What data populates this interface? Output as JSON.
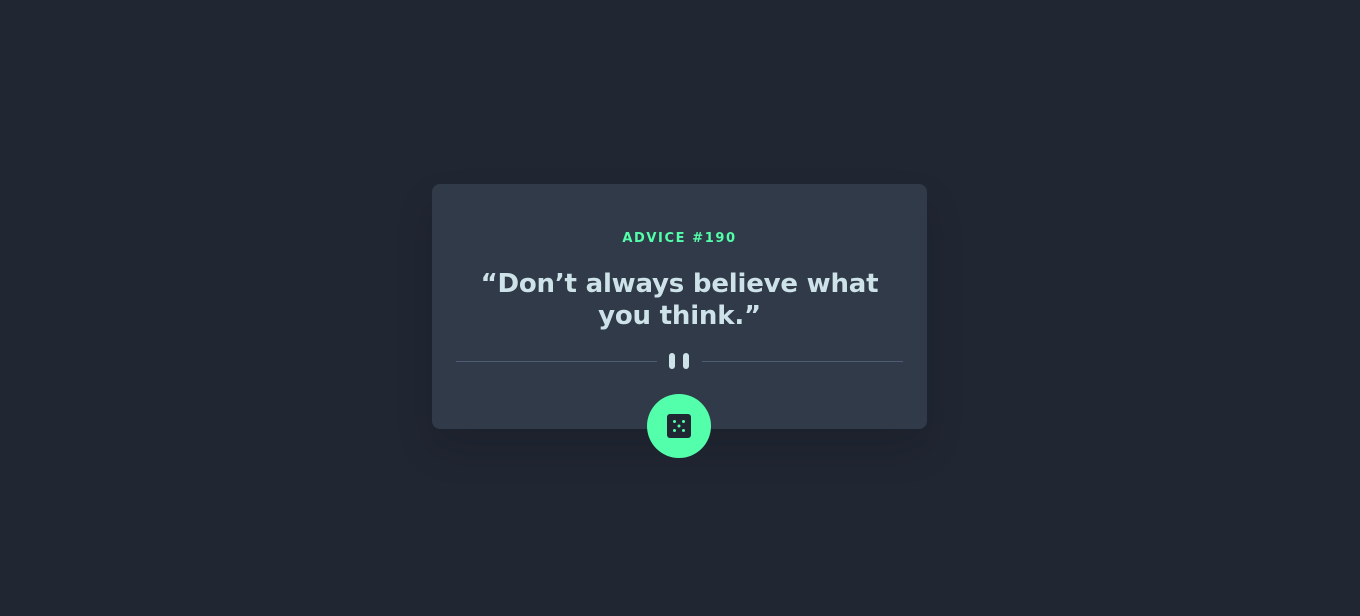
{
  "card": {
    "advice_label": "ADVICE #",
    "advice_number": "190",
    "quote": "“Don’t always believe what you think.”"
  },
  "divider": {
    "icon": "pause-icon"
  },
  "dice_button": {
    "icon": "dice-icon"
  },
  "colors": {
    "background": "#202632",
    "card": "#313a48",
    "accent": "#53ffaa",
    "text": "#cee3e9",
    "divider": "#4f5d74"
  }
}
